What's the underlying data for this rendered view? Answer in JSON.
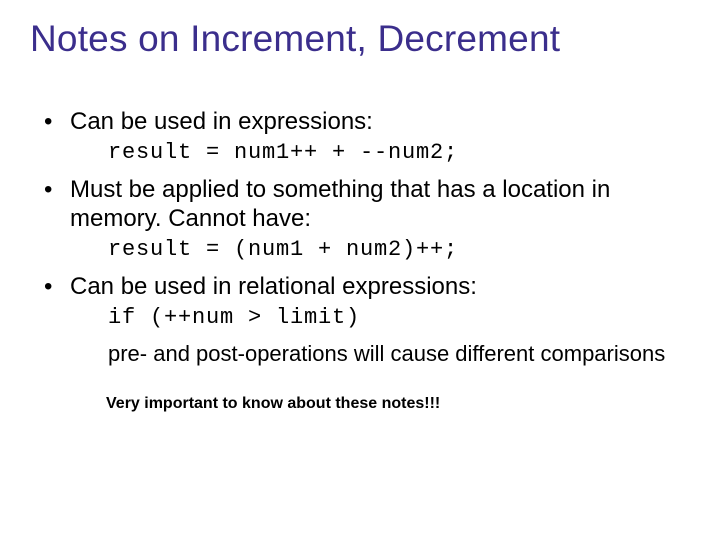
{
  "title": "Notes on Increment, Decrement",
  "bullets": [
    {
      "text": "Can be used in expressions:",
      "code": "result = num1++ + --num2;"
    },
    {
      "text": "Must be applied to something that has a location in memory. Cannot have:",
      "code": "result = (num1 + num2)++;"
    },
    {
      "text": "Can be used in relational expressions:",
      "code": "if (++num > limit)",
      "subtext": "pre- and post-operations will cause different comparisons"
    }
  ],
  "footnote": "Very important to know about these notes!!!"
}
